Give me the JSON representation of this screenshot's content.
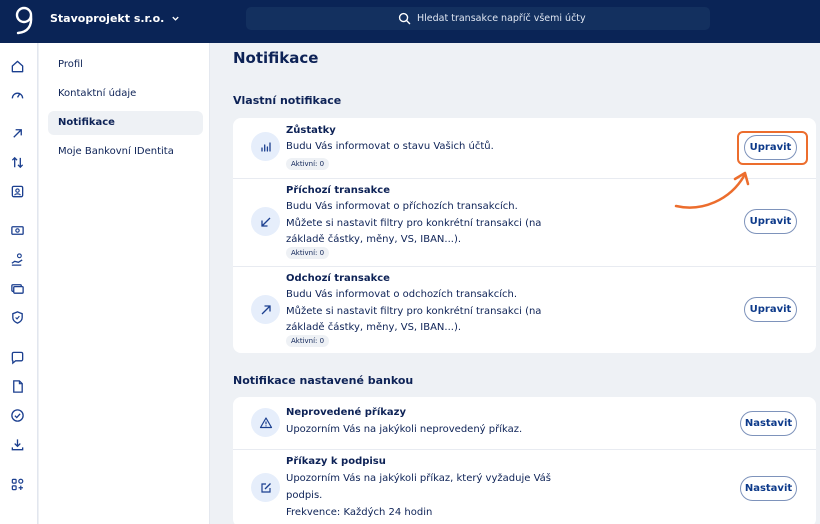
{
  "header": {
    "company_name": "Stavoprojekt s.r.o.",
    "search_placeholder": "Hledat transakce napříč všemi účty"
  },
  "rail": {
    "icons": [
      "home-icon",
      "gauge-icon",
      "arrow-up-right-icon",
      "transfer-icon",
      "contact-card-icon",
      "cash-icon",
      "hand-coin-icon",
      "cards-icon",
      "shield-icon",
      "chat-icon",
      "document-icon",
      "check-circle-icon",
      "download-icon",
      "apps-icon"
    ]
  },
  "subnav": {
    "items": [
      {
        "label": "Profil"
      },
      {
        "label": "Kontaktní údaje"
      },
      {
        "label": "Notifikace"
      },
      {
        "label": "Moje Bankovní IDentita"
      }
    ],
    "active": "Notifikace"
  },
  "main": {
    "title": "Notifikace",
    "custom": {
      "title": "Vlastní notifikace",
      "items": [
        {
          "title": "Zůstatky",
          "desc": "Budu Vás informovat o stavu Vašich účtů.",
          "badge": "Aktivní: 0",
          "button": "Upravit",
          "icon": "bar-chart-icon"
        },
        {
          "title": "Příchozí transakce",
          "desc": "Budu Vás informovat o příchozích transakcích. Můžete si nastavit filtry pro konkrétní transakci (na základě částky, měny, VS, IBAN...).",
          "badge": "Aktivní: 0",
          "button": "Upravit",
          "icon": "arrow-down-left-icon"
        },
        {
          "title": "Odchozí transakce",
          "desc": "Budu Vás informovat o odchozích transakcích. Můžete si nastavit filtry pro konkrétní transakci (na základě částky, měny, VS, IBAN...).",
          "badge": "Aktivní: 0",
          "button": "Upravit",
          "icon": "arrow-up-right-icon"
        }
      ]
    },
    "bank": {
      "title": "Notifikace nastavené bankou",
      "items": [
        {
          "title": "Neprovedené příkazy",
          "desc": "Upozorním Vás na jakýkoli neprovedený příkaz.",
          "button": "Nastavit",
          "icon": "warning-icon"
        },
        {
          "title": "Příkazy k podpisu",
          "desc": "Upozorním Vás na jakýkoli příkaz, který vyžaduje Váš podpis.",
          "frequency": "Frekvence: Každých 24 hodin",
          "button": "Nastavit",
          "icon": "edit-icon"
        }
      ]
    }
  },
  "colors": {
    "accent": "#ec6d2d",
    "navy": "#0a2456",
    "background": "#eef1f5"
  }
}
